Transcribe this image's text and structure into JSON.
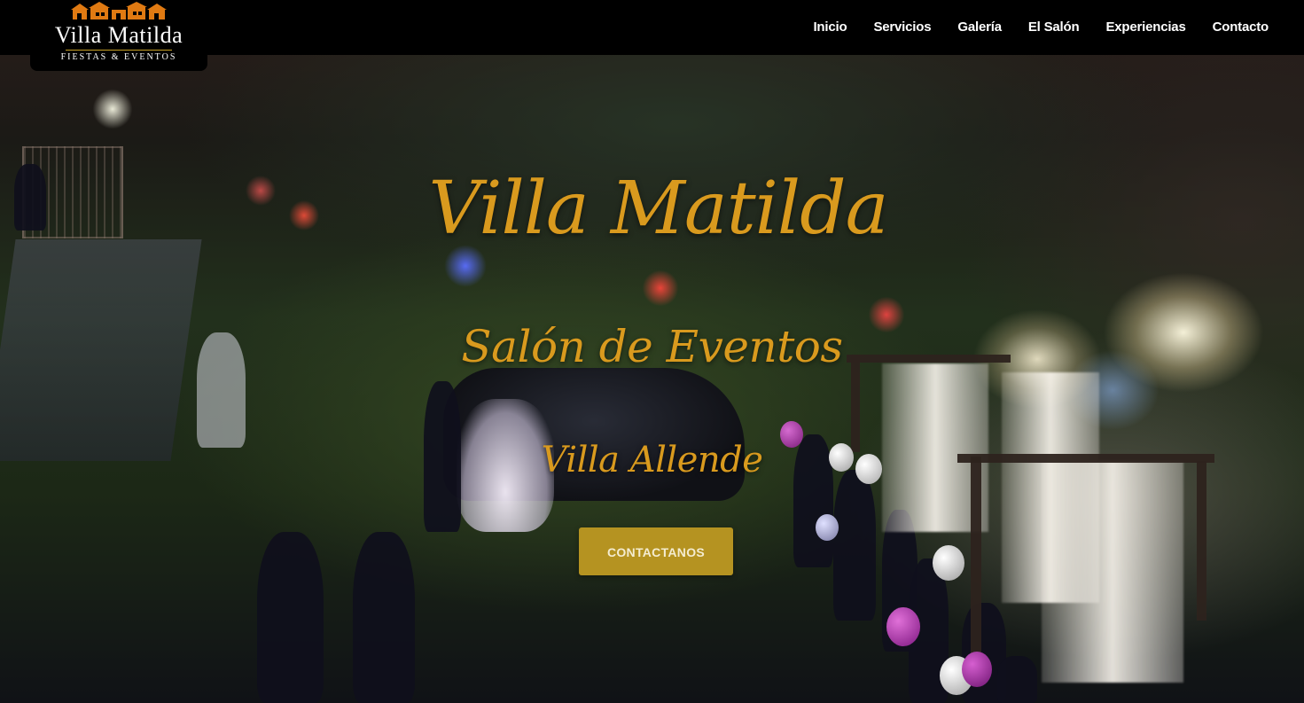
{
  "brand": {
    "name": "Villa Matilda",
    "tagline": "FIESTAS & EVENTOS",
    "accent": "#c9a227"
  },
  "nav": {
    "items": [
      {
        "label": "Inicio"
      },
      {
        "label": "Servicios"
      },
      {
        "label": "Galería"
      },
      {
        "label": "El Salón"
      },
      {
        "label": "Experiencias"
      },
      {
        "label": "Contacto"
      }
    ]
  },
  "hero": {
    "title": "Villa Matilda",
    "subtitle": "Salón de Eventos",
    "location": "Villa Allende",
    "cta_label": "CONTACTANOS",
    "title_color": "#d99a1e",
    "cta_color": "#b59321"
  }
}
